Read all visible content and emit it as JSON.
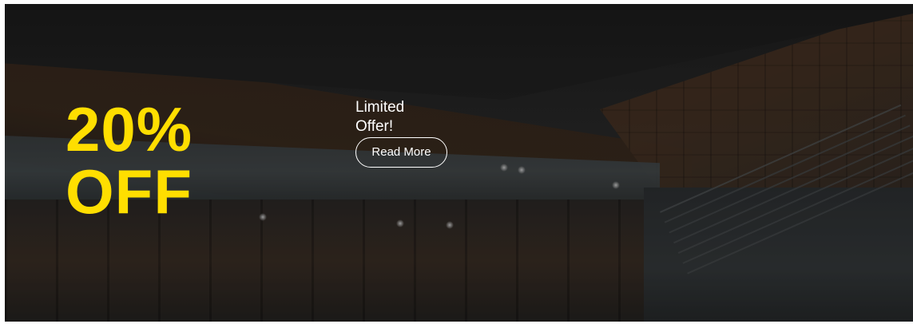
{
  "banner": {
    "discount_line1": "20%",
    "discount_line2": "OFF",
    "offer_title": "Limited Offer!",
    "cta_label": "Read More"
  },
  "colors": {
    "accent": "#ffde00",
    "text": "#ffffff",
    "overlay": "#2b2b2b"
  }
}
